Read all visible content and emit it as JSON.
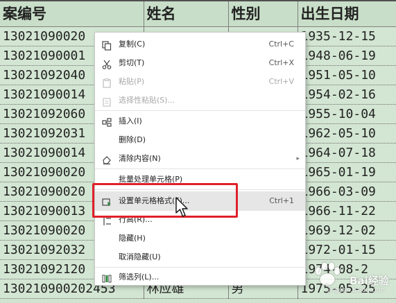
{
  "sheet": {
    "headers": [
      "案编号",
      "姓名",
      "性别",
      "出生日期"
    ],
    "rows": [
      [
        "13021090020",
        "",
        "",
        "1935-12-15"
      ],
      [
        "13021090001",
        "",
        "",
        "1948-06-19"
      ],
      [
        "13021092040",
        "",
        "",
        "1951-05-10"
      ],
      [
        "13021090014",
        "",
        "",
        "1954-02-16"
      ],
      [
        "13021092060",
        "",
        "",
        "1955-10-04"
      ],
      [
        "13021092031",
        "",
        "",
        "1962-05-10"
      ],
      [
        "13021090014",
        "",
        "",
        "1964-07-18"
      ],
      [
        "13021090020",
        "",
        "",
        "1965-01-19"
      ],
      [
        "13021090020",
        "",
        "",
        "1966-03-09"
      ],
      [
        "13021090013",
        "",
        "",
        "1966-11-22"
      ],
      [
        "13021090020",
        "",
        "",
        "1969-12-02"
      ],
      [
        "13021092032",
        "",
        "",
        "1972-01-15"
      ],
      [
        "13021092120",
        "",
        "",
        "1974-08-2"
      ],
      [
        "130210900202453",
        "林应雄",
        "男",
        "1975-05-25"
      ]
    ]
  },
  "context_menu": {
    "items": [
      {
        "id": "copy",
        "icon": "copy-icon",
        "label": "复制(C)",
        "shortcut": "Ctrl+C",
        "disabled": false
      },
      {
        "id": "cut",
        "icon": "scissors-icon",
        "label": "剪切(T)",
        "shortcut": "Ctrl+X",
        "disabled": false
      },
      {
        "id": "paste",
        "icon": "paste-icon",
        "label": "粘贴(P)",
        "shortcut": "Ctrl+V",
        "disabled": true
      },
      {
        "id": "paste-special",
        "icon": "paste-special-icon",
        "label": "选择性粘贴(S)...",
        "shortcut": "",
        "disabled": true
      },
      {
        "id": "insert",
        "icon": "insert-icon",
        "label": "插入(I)",
        "shortcut": "",
        "disabled": false
      },
      {
        "id": "delete",
        "icon": "",
        "label": "删除(D)",
        "shortcut": "",
        "disabled": false
      },
      {
        "id": "clear",
        "icon": "eraser-icon",
        "label": "清除内容(N)",
        "shortcut": "",
        "disabled": false
      },
      {
        "id": "batch",
        "icon": "",
        "label": "批量处理单元格(P)",
        "shortcut": "",
        "disabled": false
      },
      {
        "id": "format-cells",
        "icon": "format-cells-icon",
        "label": "设置单元格格式(F)...",
        "shortcut": "Ctrl+1",
        "disabled": false
      },
      {
        "id": "row-height",
        "icon": "row-height-icon",
        "label": "行高(R)...",
        "shortcut": "",
        "disabled": false
      },
      {
        "id": "hide",
        "icon": "",
        "label": "隐藏(H)",
        "shortcut": "",
        "disabled": false
      },
      {
        "id": "unhide",
        "icon": "",
        "label": "取消隐藏(U)",
        "shortcut": "",
        "disabled": false
      },
      {
        "id": "filter",
        "icon": "filter-columns-icon",
        "label": "筛选列(L)...",
        "shortcut": "",
        "disabled": false
      }
    ]
  },
  "watermark": {
    "text": "Bai经验",
    "sub": "jingyan.baidu.com"
  },
  "colors": {
    "highlight": "#e0202a",
    "sheet_bg": "#d3e6d3"
  }
}
